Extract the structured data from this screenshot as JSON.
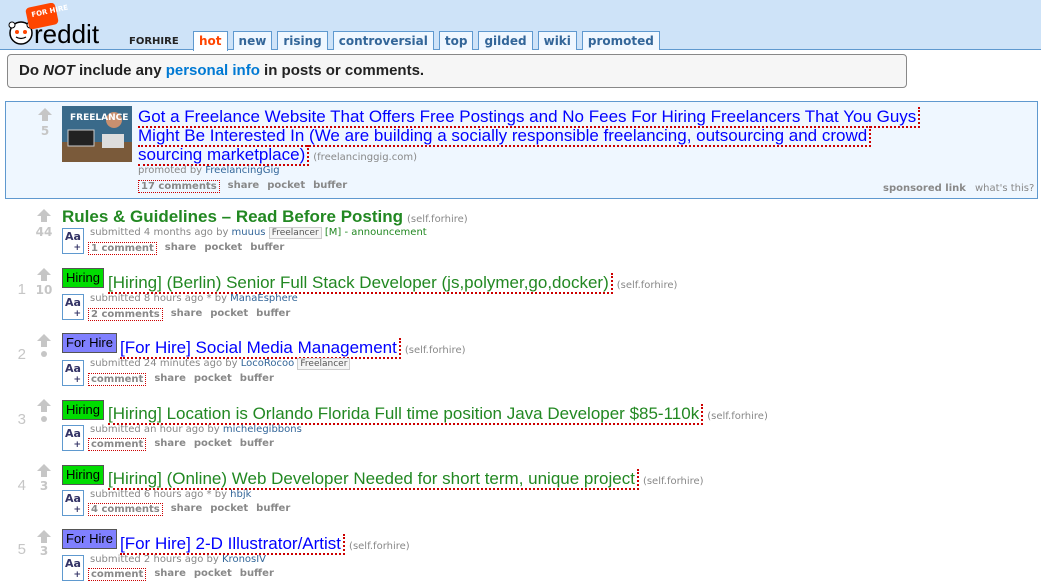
{
  "header": {
    "badge": "FOR HIRE",
    "wordmark": "reddit",
    "subreddit": "FORHIRE",
    "tabs": [
      {
        "label": "hot",
        "selected": true
      },
      {
        "label": "new"
      },
      {
        "label": "rising"
      },
      {
        "label": "controversial"
      },
      {
        "label": "top"
      },
      {
        "label": "gilded"
      },
      {
        "label": "wiki"
      },
      {
        "label": "promoted"
      }
    ]
  },
  "notice": {
    "part1": "Do ",
    "emph": "NOT",
    "part2": " include any ",
    "link": "personal info",
    "part3": " in posts or comments."
  },
  "promoted": {
    "score": "5",
    "thumb_text": "FREELANCE",
    "title_line1": "Got a Freelance Website That Offers Free Postings and No Fees For Hiring Freelancers That You Guys",
    "title_line2": "Might Be Interested In (We are building a socially responsible freelancing, outsourcing and crowd",
    "title_line3": "sourcing marketplace)",
    "domain": "(freelancinggig.com)",
    "tagline_prefix": "promoted by ",
    "author": "FreelancingGig",
    "comments": "17 comments",
    "share": "share",
    "pocket": "pocket",
    "buffer": "buffer",
    "sponsored": "sponsored link",
    "whats": "what's this?"
  },
  "posts": [
    {
      "rank": "",
      "score": "44",
      "title": "Rules & Guidelines – Read Before Posting",
      "domain": "(self.forhire)",
      "submitted": "submitted 4 months ago by ",
      "author": "muuus",
      "user_flair": "Freelancer",
      "mod": "[M]",
      "extra": " - announcement",
      "comments": "1 comment",
      "share": "share",
      "pocket": "pocket",
      "buffer": "buffer"
    },
    {
      "rank": "1",
      "score": "10",
      "flair": "Hiring",
      "title": "[Hiring] (Berlin) Senior Full Stack Developer (js,polymer,go,docker)",
      "domain": "(self.forhire)",
      "submitted": "submitted 8 hours ago * by ",
      "author": "ManaEsphere",
      "comments": "2 comments",
      "share": "share",
      "pocket": "pocket",
      "buffer": "buffer"
    },
    {
      "rank": "2",
      "score": "•",
      "flair": "For Hire",
      "title": "[For Hire] Social Media Management",
      "domain": "(self.forhire)",
      "submitted": "submitted 24 minutes ago by ",
      "author": "LocoRocoo",
      "user_flair": "Freelancer",
      "comments": "comment",
      "share": "share",
      "pocket": "pocket",
      "buffer": "buffer"
    },
    {
      "rank": "3",
      "score": "•",
      "flair": "Hiring",
      "title": "[Hiring] Location is Orlando Florida Full time position Java Developer $85-110k",
      "domain": "(self.forhire)",
      "submitted": "submitted an hour ago by ",
      "author": "michelegibbons",
      "comments": "comment",
      "share": "share",
      "pocket": "pocket",
      "buffer": "buffer"
    },
    {
      "rank": "4",
      "score": "3",
      "flair": "Hiring",
      "title": "[Hiring] (Online) Web Developer Needed for short term, unique project",
      "domain": "(self.forhire)",
      "submitted": "submitted 6 hours ago * by ",
      "author": "hbjk",
      "comments": "4 comments",
      "share": "share",
      "pocket": "pocket",
      "buffer": "buffer"
    },
    {
      "rank": "5",
      "score": "3",
      "flair": "For Hire",
      "title": "[For Hire] 2-D Illustrator/Artist",
      "domain": "(self.forhire)",
      "submitted": "submitted 2 hours ago by ",
      "author": "KronosIV",
      "comments": "comment",
      "share": "share",
      "pocket": "pocket",
      "buffer": "buffer"
    }
  ],
  "self_icon": {
    "text": "Aa",
    "plus": "+"
  },
  "colors": {
    "header_bg": "#cee3f8",
    "hiring_flair": "#00dd00",
    "forhire_flair": "#8080ff",
    "link_blue": "#0000ff",
    "link_green": "#228822"
  }
}
